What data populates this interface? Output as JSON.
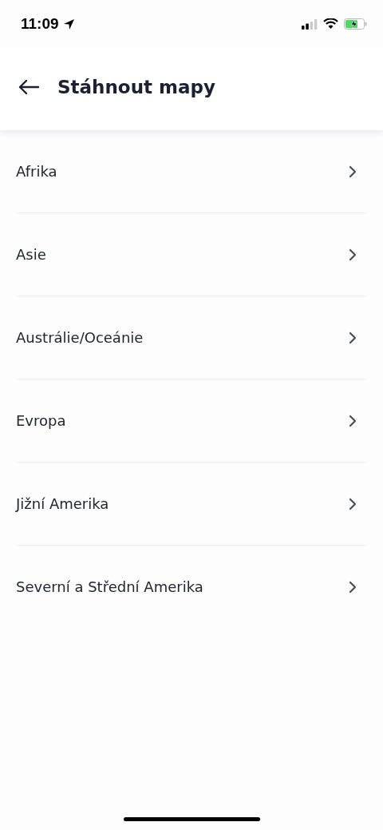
{
  "status_bar": {
    "time": "11:09"
  },
  "header": {
    "title": "Stáhnout mapy"
  },
  "regions": [
    {
      "label": "Afrika"
    },
    {
      "label": "Asie"
    },
    {
      "label": "Austrálie/Oceánie"
    },
    {
      "label": "Evropa"
    },
    {
      "label": "Jižní Amerika"
    },
    {
      "label": "Severní a Střední Amerika"
    }
  ]
}
